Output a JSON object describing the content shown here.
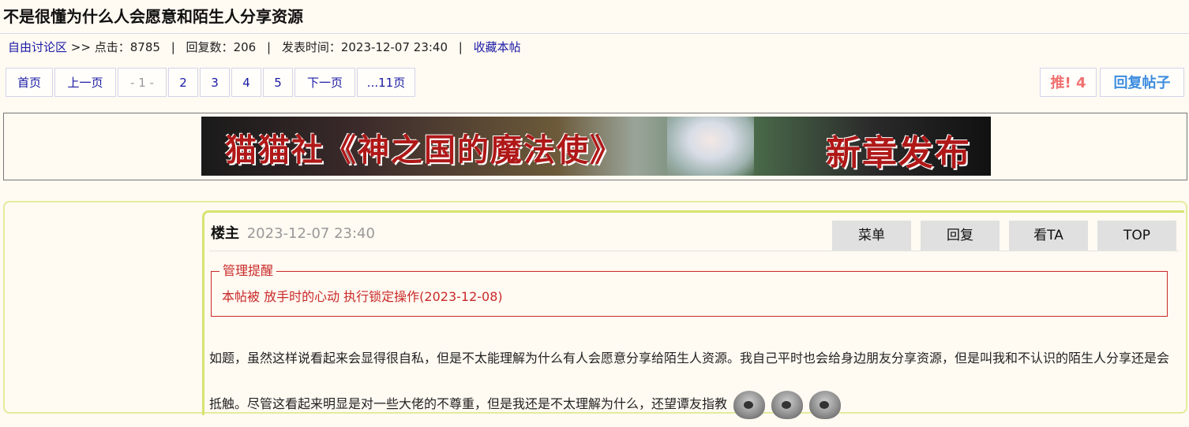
{
  "thread": {
    "title": "不是很懂为什么人会愿意和陌生人分享资源"
  },
  "meta": {
    "forum": "自由讨论区",
    "arrow": ">>",
    "views_label": "点击：",
    "views": "8785",
    "replies_label": "回复数：",
    "replies": "206",
    "posted_label": "发表时间：",
    "posted": "2023-12-07 23:40",
    "favorite": "收藏本帖",
    "sep": "|"
  },
  "pager": {
    "first": "首页",
    "prev": "上一页",
    "current": "- 1 -",
    "pages": [
      "2",
      "3",
      "4",
      "5"
    ],
    "next": "下一页",
    "last": "...11页"
  },
  "actions": {
    "push": "推! 4",
    "reply": "回复帖子"
  },
  "banner": {
    "text_left": "猫猫社《神之国的魔法使》",
    "text_right": "新章发布"
  },
  "post": {
    "author": "楼主",
    "time": "2023-12-07 23:40",
    "buttons": [
      "菜单",
      "回复",
      "看TA",
      "TOP"
    ],
    "notice_title": "管理提醒",
    "notice_text": "本帖被 放手时的心动 执行锁定操作(2023-12-08)",
    "body": "如题，虽然这样说看起来会显得很自私，但是不太能理解为什么有人会愿意分享给陌生人资源。我自己平时也会给身边朋友分享资源，但是叫我和不认识的陌生人分享还是会抵触。尽管这看起来明显是对一些大佬的不尊重，但是我还是不太理解为什么，还望谭友指教",
    "emoticons": [
      "emoticon-face",
      "emoticon-face",
      "emoticon-face"
    ]
  },
  "colors": {
    "link": "#1a1aa6",
    "push": "#f07070",
    "reply": "#3d8de0",
    "notice": "#c92a2a",
    "post_border": "#e4ec9c"
  }
}
